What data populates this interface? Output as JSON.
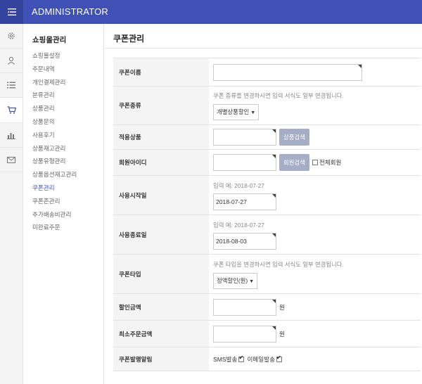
{
  "header": {
    "brand": "ADMINISTRATOR"
  },
  "sidebar": {
    "title": "쇼핑몰관리",
    "items": [
      {
        "label": "쇼핑몰설정"
      },
      {
        "label": "주문내역"
      },
      {
        "label": "개인결제관리"
      },
      {
        "label": "분류관리"
      },
      {
        "label": "상품관리"
      },
      {
        "label": "상품문의"
      },
      {
        "label": "사용후기"
      },
      {
        "label": "상품재고관리"
      },
      {
        "label": "상품유형관리"
      },
      {
        "label": "상품옵션재고관리"
      },
      {
        "label": "쿠폰관리"
      },
      {
        "label": "쿠폰존관리"
      },
      {
        "label": "추가배송비관리"
      },
      {
        "label": "미완료주문"
      }
    ]
  },
  "page": {
    "title": "쿠폰관리"
  },
  "form": {
    "coupon_name": {
      "label": "쿠폰이름",
      "value": ""
    },
    "coupon_kind": {
      "label": "쿠폰종류",
      "hint": "쿠폰 종류를 변경하시면 입력 서식도 일부 변경됩니다.",
      "selected": "개별상품할인"
    },
    "target_product": {
      "label": "적용상품",
      "value": "",
      "button": "상품검색"
    },
    "member_id": {
      "label": "회원아이디",
      "value": "",
      "button": "회원검색",
      "checkbox_label": "전체회원"
    },
    "start_date": {
      "label": "사용시작일",
      "hint": "입력 예: 2018-07-27",
      "value": "2018-07-27"
    },
    "end_date": {
      "label": "사용종료일",
      "hint": "입력 예: 2018-07-27",
      "value": "2018-08-03"
    },
    "coupon_type": {
      "label": "쿠폰타입",
      "hint": "쿠폰 타입을 변경하시면 입력 서식도 일부 변경됩니다.",
      "selected": "정액할인(원)"
    },
    "discount": {
      "label": "할인금액",
      "value": "",
      "unit": "원"
    },
    "min_order": {
      "label": "최소주문금액",
      "value": "",
      "unit": "원"
    },
    "notify": {
      "label": "쿠폰발행알림",
      "sms_label": "SMS발송",
      "sms_checked": true,
      "email_label": "이메일발송",
      "email_checked": true
    }
  }
}
